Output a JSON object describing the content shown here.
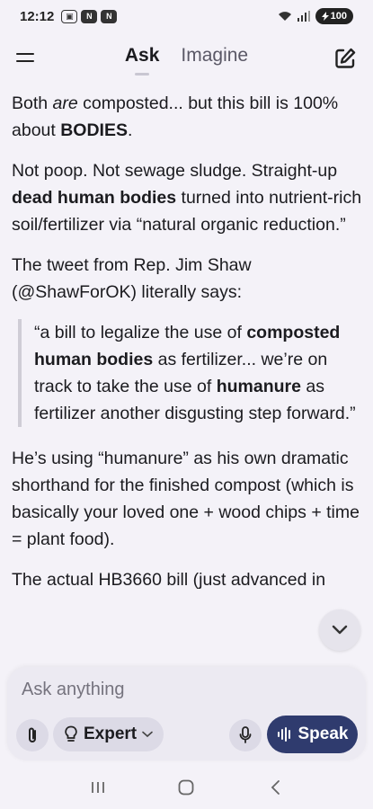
{
  "status_bar": {
    "time": "12:12",
    "battery": "100"
  },
  "header": {
    "tabs": [
      {
        "label": "Ask",
        "active": true
      },
      {
        "label": "Imagine",
        "active": false
      }
    ]
  },
  "content": {
    "p1_a": "Both ",
    "p1_em": "are",
    "p1_b": " composted... but this bill is 100% about ",
    "p1_strong": "BODIES",
    "p1_c": ".",
    "p2_a": "Not poop. Not sewage sludge. Straight-up ",
    "p2_strong": "dead human bodies",
    "p2_b": " turned into nutrient-rich soil/fertilizer via “natural organic reduction.”",
    "p3": "The tweet from Rep. Jim Shaw (@ShawForOK) literally says:",
    "quote_a": "“a bill to legalize the use of ",
    "quote_strong1": "composted human bodies",
    "quote_b": " as fertilizer... we’re on track to take the use of ",
    "quote_strong2": "humanure",
    "quote_c": " as fertilizer another disgusting step forward.”",
    "p4": "He’s using “humanure” as his own dramatic shorthand for the finished compost (which is basically your loved one + wood chips + time = plant food).",
    "p5": "The actual HB3660 bill (just advanced in"
  },
  "input": {
    "placeholder": "Ask anything",
    "value": "",
    "mode_label": "Expert",
    "speak_label": "Speak"
  },
  "colors": {
    "background": "#f4f2f8",
    "speak_button": "#2f3b6e",
    "chip": "#dcdae6"
  }
}
